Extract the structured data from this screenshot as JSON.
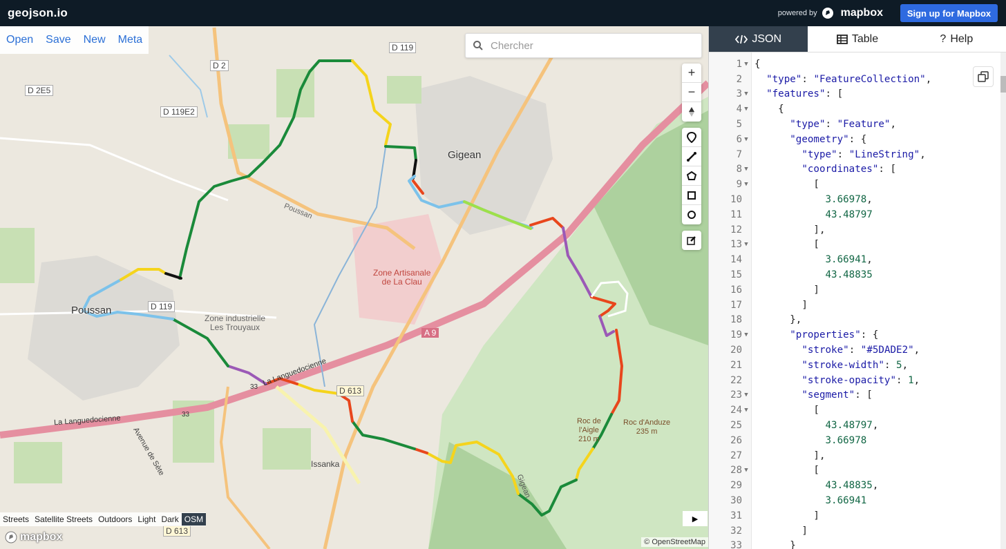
{
  "app": {
    "title": "geojson.io"
  },
  "header": {
    "powered_by": "powered by",
    "mapbox": "mapbox",
    "signup": "Sign up for Mapbox"
  },
  "menu": [
    "Open",
    "Save",
    "New",
    "Meta"
  ],
  "search": {
    "placeholder": "Chercher"
  },
  "controls": {
    "zoom_in": "+",
    "zoom_out": "−"
  },
  "map_labels": {
    "d119_top": "D 119",
    "d2": "D 2",
    "d2e5": "D 2E5",
    "d119e2": "D 119E2",
    "d119": "D 119",
    "gigean": "Gigean",
    "poussan": "Poussan",
    "poussan_road": "Poussan",
    "zone_artisanale": "Zone Artisanale\nde La Clau",
    "zone_industrielle": "Zone industrielle\nLes Trouyaux",
    "a9": "A 9",
    "la_languedocienne_1": "La Languedocienne",
    "la_languedocienne_2": "La Languedocienne",
    "r33_1": "33",
    "r33_2": "33",
    "d613": "D 613",
    "d613_bottom": "D 613",
    "avenue_de_sete": "Avenue de Sète",
    "issanka": "Issanka",
    "roc_aigle": "Roc de\nl'Aigle\n210 m",
    "roc_anduze": "Roc d'Anduze\n235 m",
    "gigean_road": "Gigean"
  },
  "map_styles": [
    "Streets",
    "Satellite Streets",
    "Outdoors",
    "Light",
    "Dark",
    "OSM"
  ],
  "active_style": "OSM",
  "attribution": "© OpenStreetMap",
  "tabs": [
    {
      "label": "JSON",
      "icon": "code-icon"
    },
    {
      "label": "Table",
      "icon": "table-icon"
    },
    {
      "label": "Help",
      "icon": "help-icon"
    }
  ],
  "code_lines": [
    {
      "n": "1",
      "fold": true,
      "text": "{"
    },
    {
      "n": "2",
      "fold": false,
      "text": "  \"type\": \"FeatureCollection\","
    },
    {
      "n": "3",
      "fold": true,
      "text": "  \"features\": ["
    },
    {
      "n": "4",
      "fold": true,
      "text": "    {"
    },
    {
      "n": "5",
      "fold": false,
      "text": "      \"type\": \"Feature\","
    },
    {
      "n": "6",
      "fold": true,
      "text": "      \"geometry\": {"
    },
    {
      "n": "7",
      "fold": false,
      "text": "        \"type\": \"LineString\","
    },
    {
      "n": "8",
      "fold": true,
      "text": "        \"coordinates\": ["
    },
    {
      "n": "9",
      "fold": true,
      "text": "          ["
    },
    {
      "n": "10",
      "fold": false,
      "text": "            3.66978,"
    },
    {
      "n": "11",
      "fold": false,
      "text": "            43.48797"
    },
    {
      "n": "12",
      "fold": false,
      "text": "          ],"
    },
    {
      "n": "13",
      "fold": true,
      "text": "          ["
    },
    {
      "n": "14",
      "fold": false,
      "text": "            3.66941,"
    },
    {
      "n": "15",
      "fold": false,
      "text": "            43.48835"
    },
    {
      "n": "16",
      "fold": false,
      "text": "          ]"
    },
    {
      "n": "17",
      "fold": false,
      "text": "        ]"
    },
    {
      "n": "18",
      "fold": false,
      "text": "      },"
    },
    {
      "n": "19",
      "fold": true,
      "text": "      \"properties\": {"
    },
    {
      "n": "20",
      "fold": false,
      "text": "        \"stroke\": \"#5DADE2\","
    },
    {
      "n": "21",
      "fold": false,
      "text": "        \"stroke-width\": 5,"
    },
    {
      "n": "22",
      "fold": false,
      "text": "        \"stroke-opacity\": 1,"
    },
    {
      "n": "23",
      "fold": true,
      "text": "        \"segment\": ["
    },
    {
      "n": "24",
      "fold": true,
      "text": "          ["
    },
    {
      "n": "25",
      "fold": false,
      "text": "            43.48797,"
    },
    {
      "n": "26",
      "fold": false,
      "text": "            3.66978"
    },
    {
      "n": "27",
      "fold": false,
      "text": "          ],"
    },
    {
      "n": "28",
      "fold": true,
      "text": "          ["
    },
    {
      "n": "29",
      "fold": false,
      "text": "            43.48835,"
    },
    {
      "n": "30",
      "fold": false,
      "text": "            3.66941"
    },
    {
      "n": "31",
      "fold": false,
      "text": "          ]"
    },
    {
      "n": "32",
      "fold": false,
      "text": "        ]"
    },
    {
      "n": "33",
      "fold": false,
      "text": "      }"
    }
  ],
  "colors": {
    "topbar": "#0e1b26",
    "accent": "#2e6ae0",
    "active_tab": "#33404d"
  }
}
